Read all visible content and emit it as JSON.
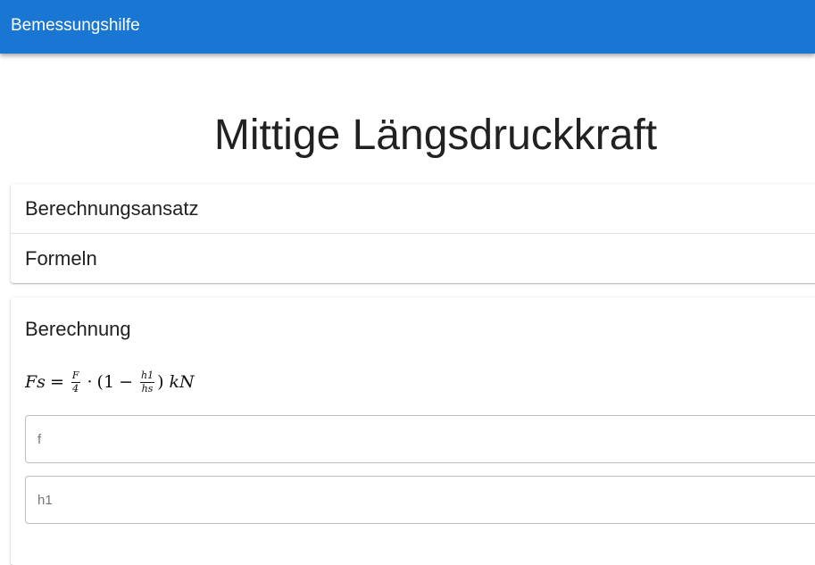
{
  "appbar": {
    "title": "Bemessungshilfe"
  },
  "page": {
    "title": "Mittige Längsdruckkraft"
  },
  "accordion": {
    "items": [
      {
        "label": "Berechnungsansatz"
      },
      {
        "label": "Formeln"
      }
    ]
  },
  "calculation": {
    "title": "Berechnung",
    "formula": {
      "lhs": "Fs",
      "equals": "=",
      "frac1_num": "F",
      "frac1_den": "4",
      "dot": "·",
      "open": "(1",
      "minus": "−",
      "frac2_num": "h1",
      "frac2_den": "hs",
      "close": ")",
      "unit": "kN"
    },
    "fields": [
      {
        "placeholder": "f",
        "value": ""
      },
      {
        "placeholder": "h1",
        "value": ""
      }
    ]
  }
}
